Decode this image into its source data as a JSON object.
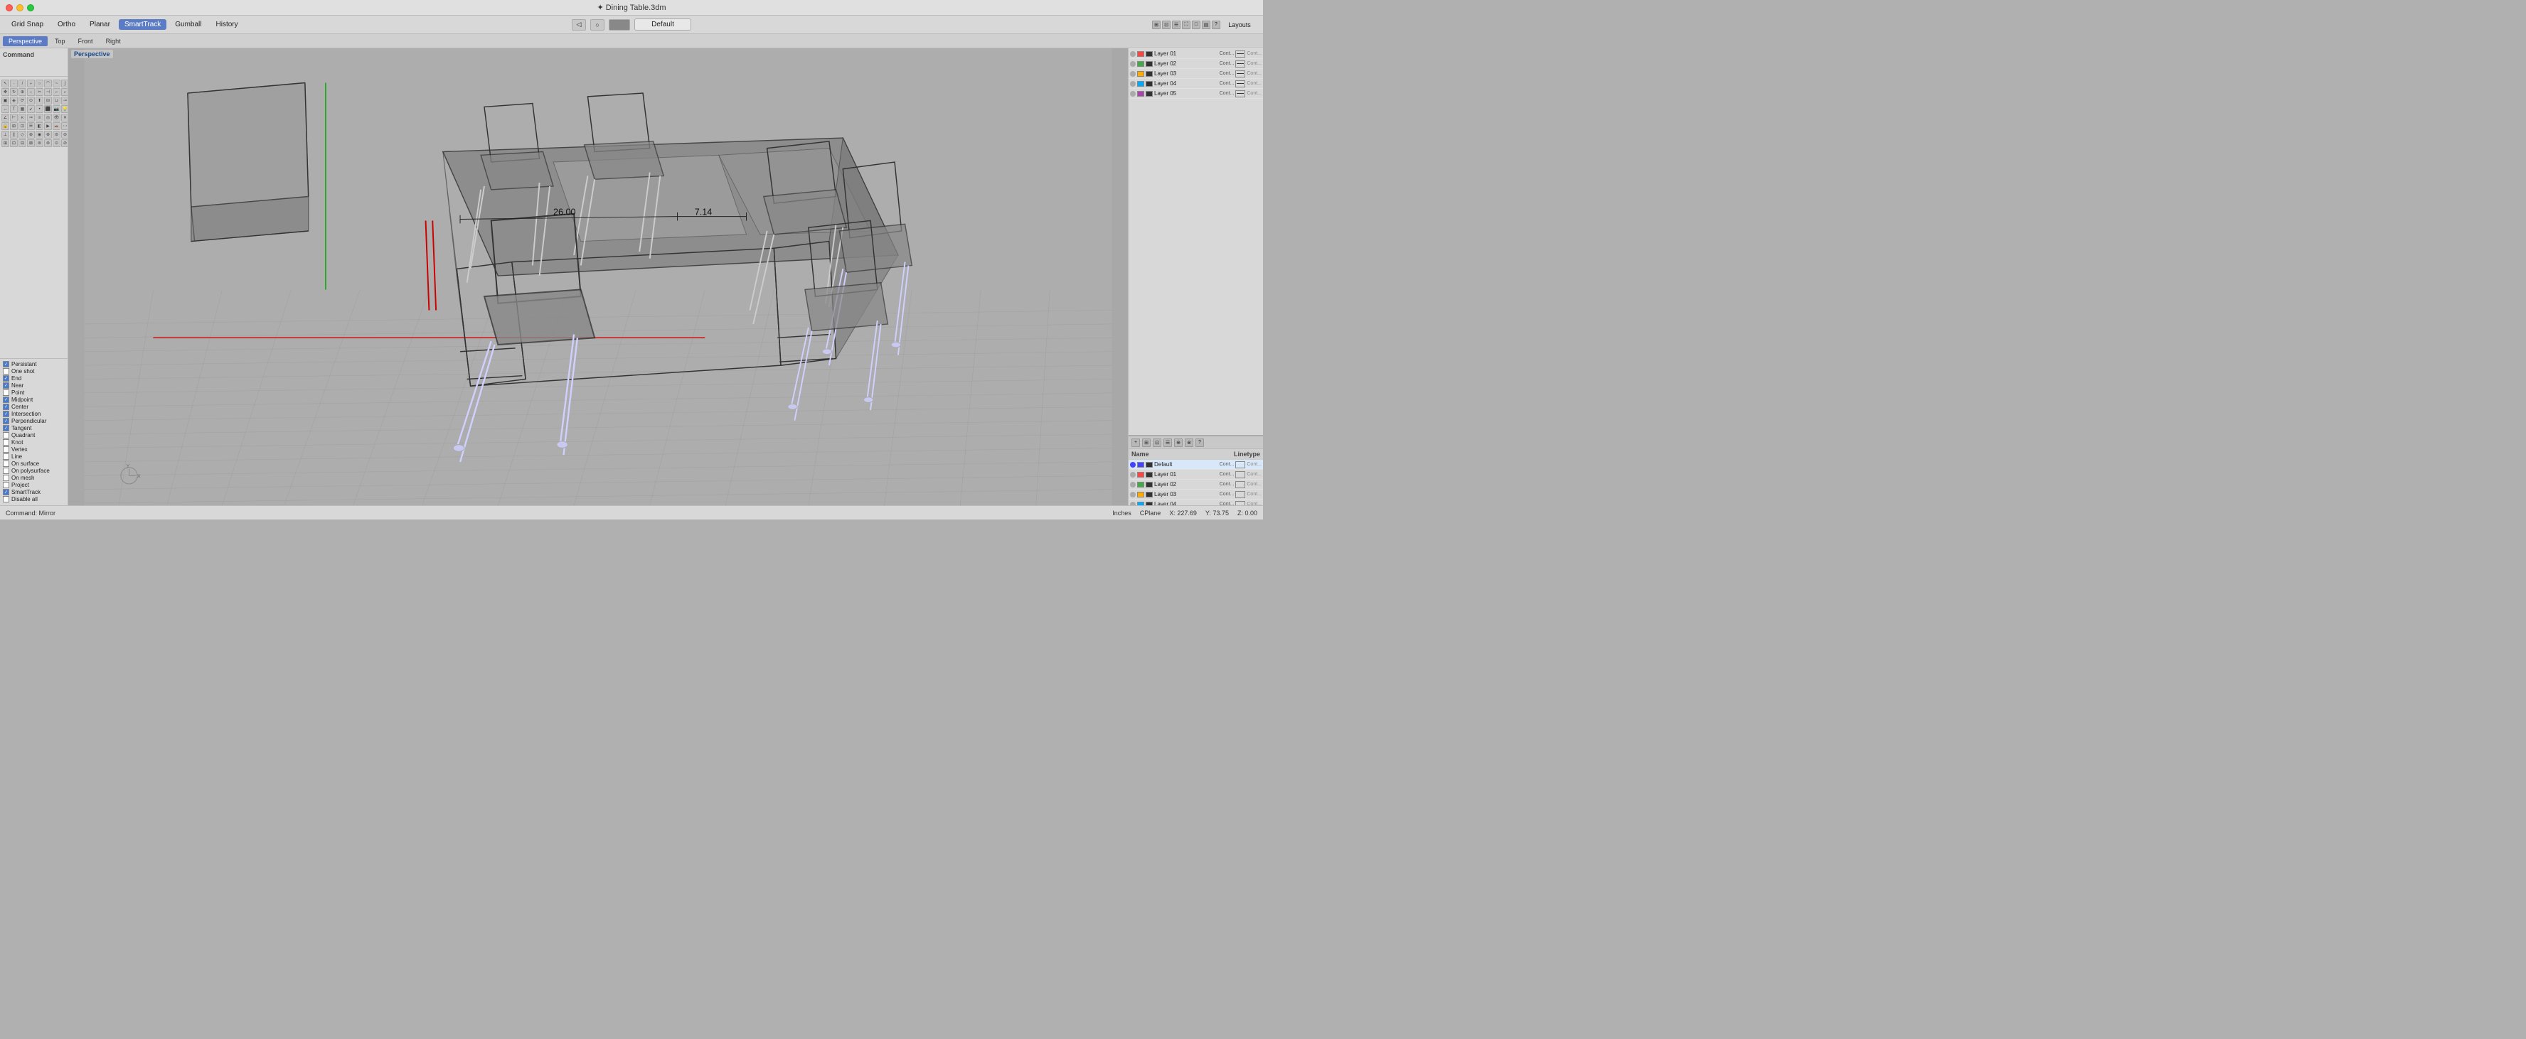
{
  "titlebar": {
    "title": "✦ Dining Table.3dm"
  },
  "toolbar": {
    "buttons": [
      "Grid Snap",
      "Ortho",
      "Planar",
      "SmartTrack",
      "Gumball",
      "History"
    ],
    "active": "SmartTrack",
    "default_dropdown": "Default",
    "layouts_label": "Layouts"
  },
  "tabs": {
    "views": [
      "Perspective",
      "Top",
      "Front",
      "Right"
    ],
    "active": "Perspective"
  },
  "viewport": {
    "label": "Perspective",
    "dim1": "26.00",
    "dim2": "7.14"
  },
  "layers": {
    "columns": [
      "Name",
      "Linetype"
    ],
    "items": [
      {
        "name": "Default",
        "color": "#4444ff",
        "cont": "Cont...",
        "linetype": "Cont...",
        "active": true
      },
      {
        "name": "Layer 01",
        "color": "#ff4444",
        "cont": "Cont...",
        "linetype": "Cont..."
      },
      {
        "name": "Layer 02",
        "color": "#44aa44",
        "cont": "Cont...",
        "linetype": "Cont..."
      },
      {
        "name": "Layer 03",
        "color": "#ffaa00",
        "cont": "Cont...",
        "linetype": "Cont..."
      },
      {
        "name": "Layer 04",
        "color": "#00aaff",
        "cont": "Cont...",
        "linetype": "Cont..."
      },
      {
        "name": "Layer 05",
        "color": "#aa44aa",
        "cont": "Cont...",
        "linetype": "Cont..."
      }
    ]
  },
  "command": {
    "label": "Command",
    "current": "Command: Mirror"
  },
  "osnap": {
    "items": [
      {
        "label": "Persistant",
        "checked": true
      },
      {
        "label": "One shot",
        "checked": false
      },
      {
        "label": "End",
        "checked": true
      },
      {
        "label": "Near",
        "checked": true
      },
      {
        "label": "Point",
        "checked": false
      },
      {
        "label": "Midpoint",
        "checked": true
      },
      {
        "label": "Center",
        "checked": true
      },
      {
        "label": "Intersection",
        "checked": true
      },
      {
        "label": "Perpendicular",
        "checked": true
      },
      {
        "label": "Tangent",
        "checked": true
      },
      {
        "label": "Quadrant",
        "checked": false
      },
      {
        "label": "Knot",
        "checked": false
      },
      {
        "label": "Vertex",
        "checked": false
      },
      {
        "label": "Line",
        "checked": false
      },
      {
        "label": "On surface",
        "checked": false
      },
      {
        "label": "On polysurface",
        "checked": false
      },
      {
        "label": "On mesh",
        "checked": false
      },
      {
        "label": "Project",
        "checked": false
      },
      {
        "label": "SmartTrack",
        "checked": true
      },
      {
        "label": "Disable all",
        "checked": false
      }
    ]
  },
  "statusbar": {
    "command": "Command: Mirror",
    "units": "Inches",
    "cplane": "CPlane",
    "x_label": "X:",
    "x_value": "227.69",
    "y_label": "Y:",
    "y_value": "73.75",
    "z_label": "Z:",
    "z_value": "0.00"
  }
}
